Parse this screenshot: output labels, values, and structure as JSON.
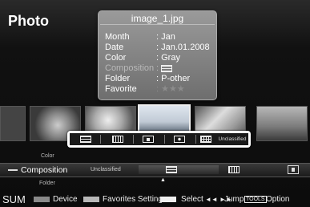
{
  "page": {
    "title": "Photo"
  },
  "info": {
    "filename": "image_1.jpg",
    "rows": [
      {
        "key": "Month",
        "value": ": Jan"
      },
      {
        "key": "Date",
        "value": ": Jan.01.2008"
      },
      {
        "key": "Color",
        "value": ": Gray"
      },
      {
        "key": "Composition",
        "value": ":"
      },
      {
        "key": "Folder",
        "value": ": P-other"
      },
      {
        "key": "Favorite",
        "value": ": ★★★"
      }
    ]
  },
  "thumbnails": {
    "selected_index": 2
  },
  "filter_bar": {
    "items": [
      "horizontal-lines",
      "vertical-lines",
      "object",
      "symmetric",
      "grid"
    ],
    "last_label": "Unclassified"
  },
  "sort": {
    "above_label": "Color",
    "current_label": "Composition",
    "below_label": "Folder",
    "unclassified_label": "Unclassified"
  },
  "legend": {
    "sum": "SUM",
    "device": "Device",
    "favorites": "Favorites Setting",
    "select": "Select",
    "jump_arrows": "◄◄ ►►",
    "jump": "Jump",
    "tools": "TOOLS",
    "option": "Option"
  }
}
